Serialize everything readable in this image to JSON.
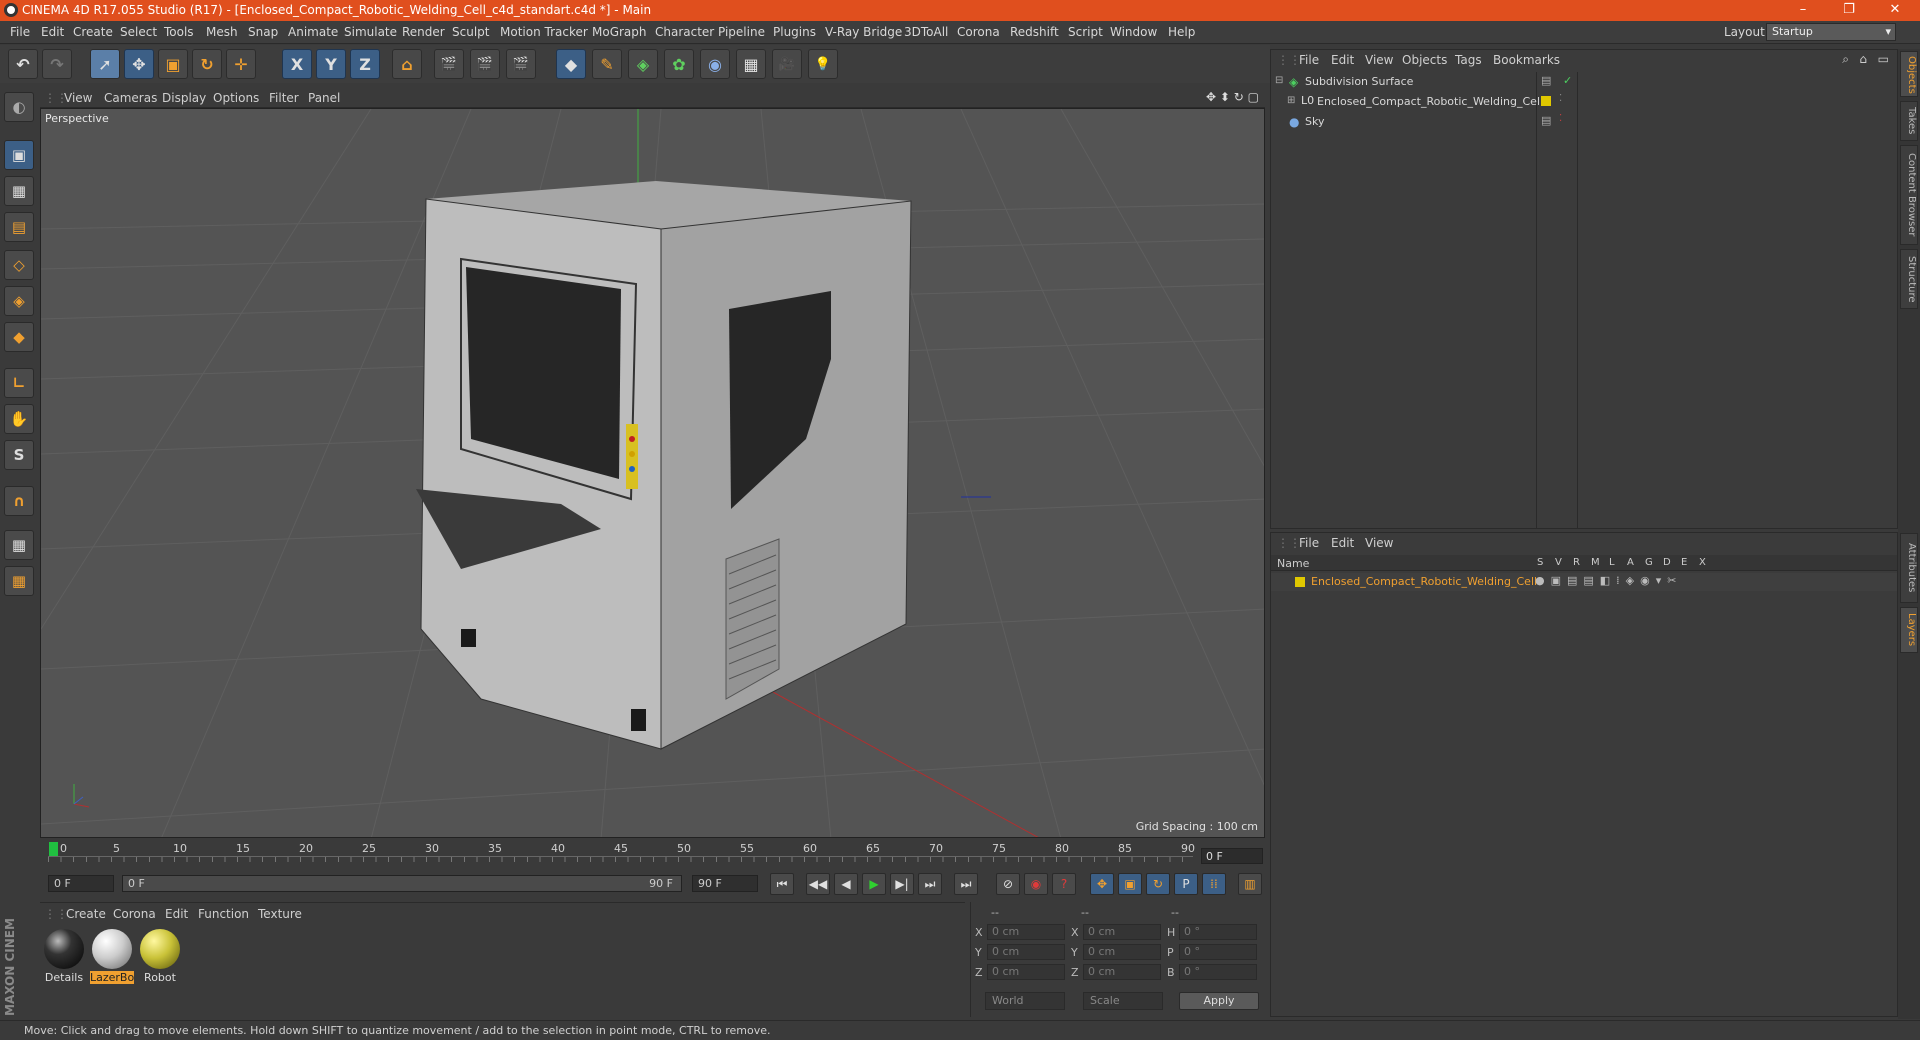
{
  "window": {
    "title": "CINEMA 4D R17.055 Studio (R17) - [Enclosed_Compact_Robotic_Welding_Cell_c4d_standart.c4d *] - Main",
    "minimize": "–",
    "restore": "❐",
    "close": "✕"
  },
  "menu": [
    "File",
    "Edit",
    "Create",
    "Select",
    "Tools",
    "Mesh",
    "Snap",
    "Animate",
    "Simulate",
    "Render",
    "Sculpt",
    "Motion Tracker",
    "MoGraph",
    "Character",
    "Pipeline",
    "Plugins",
    "V-Ray Bridge",
    "3DToAll",
    "Corona",
    "Redshift",
    "Script",
    "Window",
    "Help"
  ],
  "layout": {
    "label": "Layout:",
    "value": "Startup"
  },
  "toolbar": {
    "undo": "↶",
    "redo": "↷",
    "select": "➚",
    "move": "✥",
    "scale": "▣",
    "rotate": "↻",
    "last_tool": "✛",
    "x_axis": "X",
    "y_axis": "Y",
    "z_axis": "Z",
    "coord_system": "⌂",
    "render_view": "🎬",
    "render_pic": "🎬",
    "render_settings": "🎬",
    "cube": "◆",
    "pen": "✎",
    "subdiv": "◈",
    "cloner": "✿",
    "deformer": "◉",
    "floor": "▦",
    "camera": "🎥",
    "light": "💡"
  },
  "viewport": {
    "menu": [
      "View",
      "Cameras",
      "Display",
      "Options",
      "Filter",
      "Panel"
    ],
    "label": "Perspective",
    "grid_spacing": "Grid Spacing : 100 cm",
    "nav_icons": "✥ ⬍ ↻ ▢"
  },
  "timeline": {
    "ticks": [
      "0",
      "5",
      "10",
      "15",
      "20",
      "25",
      "30",
      "35",
      "40",
      "45",
      "50",
      "55",
      "60",
      "65",
      "70",
      "75",
      "80",
      "85",
      "90"
    ],
    "current_frame": "0 F"
  },
  "transport": {
    "start_field": "0 F",
    "range_start": "0 F",
    "range_end": "90 F",
    "end_field": "90 F",
    "buttons": [
      "⏮",
      "◀◀",
      "◀",
      "▶",
      "▶|",
      "⏭",
      "⏭"
    ]
  },
  "materials": {
    "menu": [
      "Create",
      "Corona",
      "Edit",
      "Function",
      "Texture"
    ],
    "items": [
      {
        "name": "Details",
        "color": "#1c1c1c"
      },
      {
        "name": "LazerBo",
        "color": "#d8d8d8"
      },
      {
        "name": "Robot",
        "color": "#c9c238"
      }
    ]
  },
  "coords": {
    "header": [
      "--",
      "--",
      "--"
    ],
    "rows": [
      {
        "a": "X",
        "v1": "0 cm",
        "b": "X",
        "v2": "0 cm",
        "c": "H",
        "v3": "0 °"
      },
      {
        "a": "Y",
        "v1": "0 cm",
        "b": "Y",
        "v2": "0 cm",
        "c": "P",
        "v3": "0 °"
      },
      {
        "a": "Z",
        "v1": "0 cm",
        "b": "Z",
        "v2": "0 cm",
        "c": "B",
        "v3": "0 °"
      }
    ],
    "world": "World",
    "scale": "Scale",
    "apply": "Apply"
  },
  "status": "Move: Click and drag to move elements. Hold down SHIFT to quantize movement / add to the selection in point mode, CTRL to remove.",
  "maxon_logo": "MAXON CINEMA 4D",
  "objects": {
    "menu": [
      "File",
      "Edit",
      "View",
      "Objects",
      "Tags",
      "Bookmarks"
    ],
    "items": [
      {
        "name": "Subdivision Surface",
        "tag_check": "✓"
      },
      {
        "name": "Enclosed_Compact_Robotic_Welding_Cell"
      },
      {
        "name": "Sky"
      }
    ]
  },
  "layers": {
    "menu": [
      "File",
      "Edit",
      "View"
    ],
    "columns": {
      "name": "Name",
      "flags": [
        "S",
        "V",
        "R",
        "M",
        "L",
        "A",
        "G",
        "D",
        "E",
        "X"
      ]
    },
    "items": [
      {
        "name": "Enclosed_Compact_Robotic_Welding_Cell",
        "color": "#e0c800"
      }
    ]
  },
  "right_tabs": [
    "Objects",
    "Takes",
    "Content Browser",
    "Structure",
    "Attributes",
    "Layers"
  ]
}
